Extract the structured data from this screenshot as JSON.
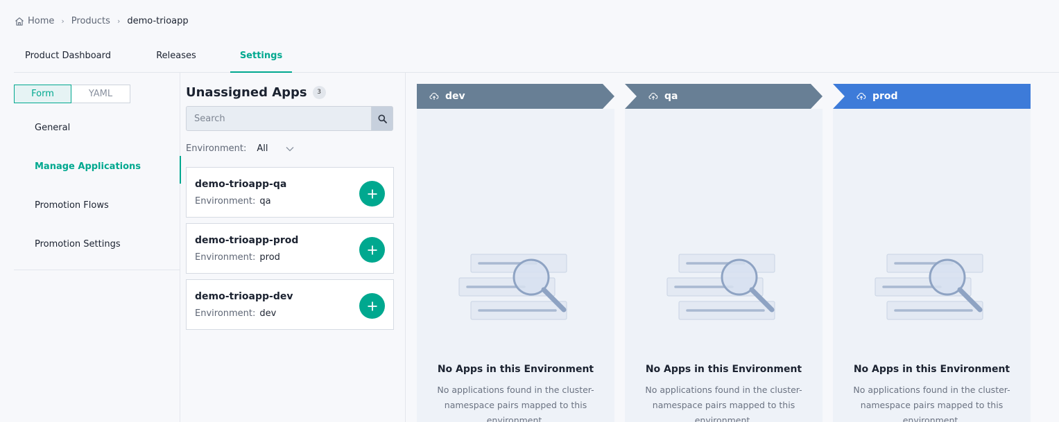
{
  "breadcrumb": {
    "home": "Home",
    "products": "Products",
    "current": "demo-trioapp",
    "separator": "›"
  },
  "tabs": [
    {
      "label": "Product Dashboard",
      "active": false
    },
    {
      "label": "Releases",
      "active": false
    },
    {
      "label": "Settings",
      "active": true
    }
  ],
  "view_toggle": {
    "form": "Form",
    "yaml": "YAML",
    "selected": "Form"
  },
  "sidebar": {
    "items": [
      {
        "label": "General",
        "active": false
      },
      {
        "label": "Manage Applications",
        "active": true
      },
      {
        "label": "Promotion Flows",
        "active": false
      },
      {
        "label": "Promotion Settings",
        "active": false
      }
    ]
  },
  "unassigned": {
    "title": "Unassigned Apps",
    "count": "3",
    "search_placeholder": "Search",
    "env_filter_label": "Environment:",
    "env_filter_value": "All",
    "apps": [
      {
        "name": "demo-trioapp-qa",
        "env_label": "Environment:",
        "env": "qa"
      },
      {
        "name": "demo-trioapp-prod",
        "env_label": "Environment:",
        "env": "prod"
      },
      {
        "name": "demo-trioapp-dev",
        "env_label": "Environment:",
        "env": "dev"
      }
    ]
  },
  "environments": [
    {
      "name": "dev",
      "color": "#687f95",
      "empty_title": "No Apps in this Environment",
      "empty_desc": "No applications found in the cluster-namespace pairs mapped to this environment."
    },
    {
      "name": "qa",
      "color": "#687f95",
      "empty_title": "No Apps in this Environment",
      "empty_desc": "No applications found in the cluster-namespace pairs mapped to this environment."
    },
    {
      "name": "prod",
      "color": "#3d7bd9",
      "empty_title": "No Apps in this Environment",
      "empty_desc": "No applications found in the cluster-namespace pairs mapped to this environment."
    }
  ],
  "colors": {
    "accent": "#00a88f",
    "env_default": "#687f95",
    "env_prod": "#3d7bd9"
  },
  "icons": [
    "home-icon",
    "search-icon",
    "chevron-down-icon",
    "plus-icon",
    "cloud-upload-icon",
    "empty-search-illustration"
  ]
}
